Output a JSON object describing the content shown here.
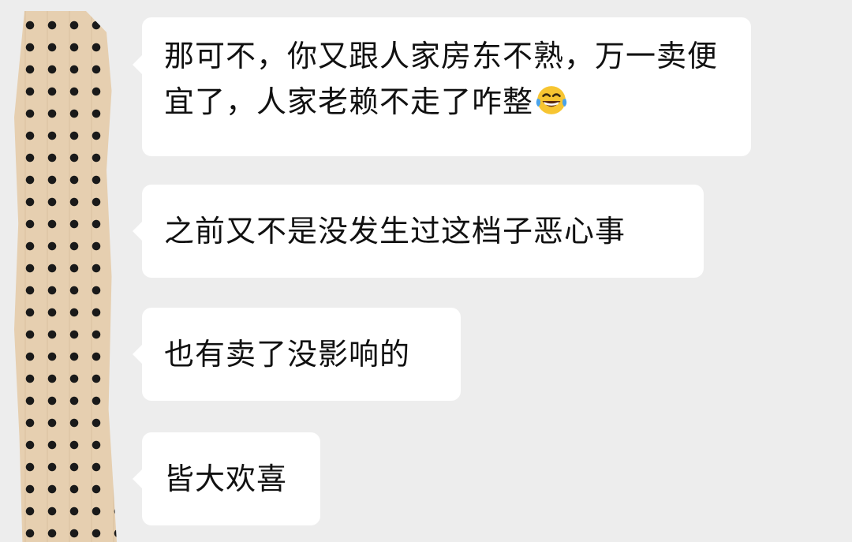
{
  "messages": [
    {
      "text": "那可不，你又跟人家房东不熟，万一卖便宜了，人家老赖不走了咋整",
      "emoji": "laughing-tears-emoji"
    },
    {
      "text": "之前又不是没发生过这档子恶心事"
    },
    {
      "text": "也有卖了没影响的"
    },
    {
      "text": "皆大欢喜"
    }
  ],
  "colors": {
    "background": "#ededed",
    "bubble": "#ffffff",
    "text": "#111111"
  }
}
